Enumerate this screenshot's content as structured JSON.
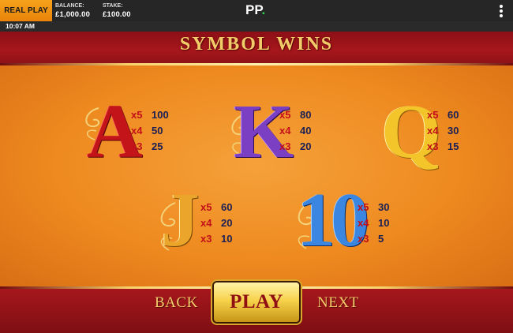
{
  "topbar": {
    "mode_label": "REAL PLAY",
    "balance_label": "BALANCE:",
    "balance_value": "£1,000.00",
    "stake_label": "STAKE:",
    "stake_value": "£100.00",
    "logo_text": "PP",
    "logo_dot": ".",
    "menu_icon": "kebab-menu-icon"
  },
  "clock": "10:07 AM",
  "title": "SYMBOL WINS",
  "symbols": [
    {
      "glyph": "A",
      "color": "#c3141a",
      "pays": [
        {
          "mult": "x5",
          "amount": "100"
        },
        {
          "mult": "x4",
          "amount": "50"
        },
        {
          "mult": "x3",
          "amount": "25"
        }
      ]
    },
    {
      "glyph": "K",
      "color": "#7a3fc2",
      "pays": [
        {
          "mult": "x5",
          "amount": "80"
        },
        {
          "mult": "x4",
          "amount": "40"
        },
        {
          "mult": "x3",
          "amount": "20"
        }
      ]
    },
    {
      "glyph": "Q",
      "color": "#f3c52a",
      "pays": [
        {
          "mult": "x5",
          "amount": "60"
        },
        {
          "mult": "x4",
          "amount": "30"
        },
        {
          "mult": "x3",
          "amount": "15"
        }
      ]
    },
    {
      "glyph": "J",
      "color": "#eaa52a",
      "pays": [
        {
          "mult": "x5",
          "amount": "60"
        },
        {
          "mult": "x4",
          "amount": "20"
        },
        {
          "mult": "x3",
          "amount": "10"
        }
      ]
    },
    {
      "glyph": "10",
      "color": "#3a86e0",
      "pays": [
        {
          "mult": "x5",
          "amount": "30"
        },
        {
          "mult": "x4",
          "amount": "10"
        },
        {
          "mult": "x3",
          "amount": "5"
        }
      ]
    }
  ],
  "nav": {
    "back": "BACK",
    "play": "PLAY",
    "next": "NEXT"
  },
  "colors": {
    "accent_gold": "#f3cc6a",
    "background_orange": "#ee8a1f",
    "band_red": "#9e1519",
    "brand_green": "#2fcf49"
  }
}
